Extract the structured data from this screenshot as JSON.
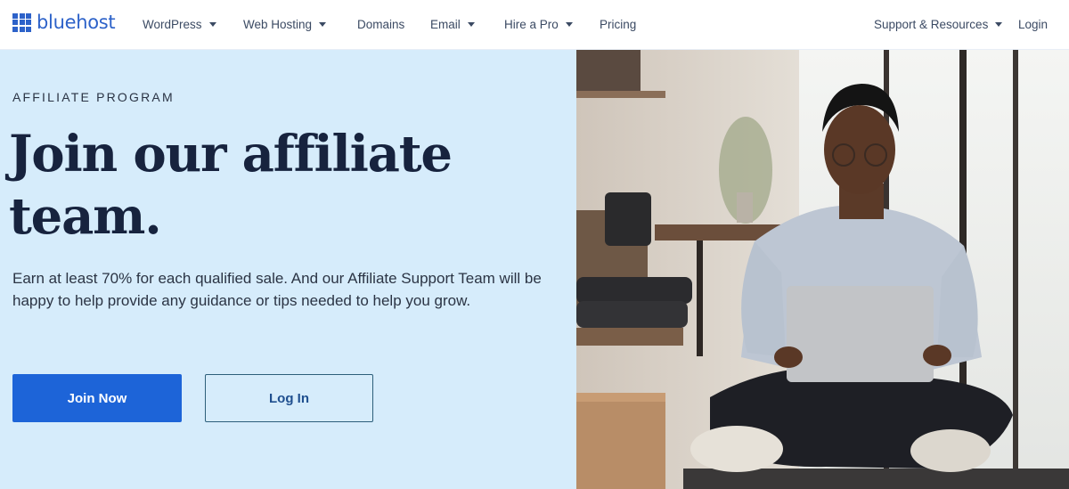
{
  "brand": {
    "name": "bluehost",
    "color": "#2d62c9"
  },
  "nav": {
    "items": [
      {
        "label": "WordPress",
        "dropdown": true
      },
      {
        "label": "Web Hosting",
        "dropdown": true
      },
      {
        "label": "Domains",
        "dropdown": false
      },
      {
        "label": "Email",
        "dropdown": true
      },
      {
        "label": "Hire a Pro",
        "dropdown": true
      },
      {
        "label": "Pricing",
        "dropdown": false
      }
    ],
    "right": [
      {
        "label": "Support & Resources",
        "dropdown": true
      },
      {
        "label": "Login",
        "dropdown": false
      }
    ]
  },
  "hero": {
    "eyebrow": "AFFILIATE PROGRAM",
    "headline": "Join our affiliate team.",
    "body": "Earn at least 70% for each qualified sale. And our Affiliate Support Team will be happy to help provide any guidance or tips needed to help you grow.",
    "primary_button": "Join Now",
    "secondary_button": "Log In",
    "background": "#d6ecfb",
    "accent": "#1d64d8"
  }
}
